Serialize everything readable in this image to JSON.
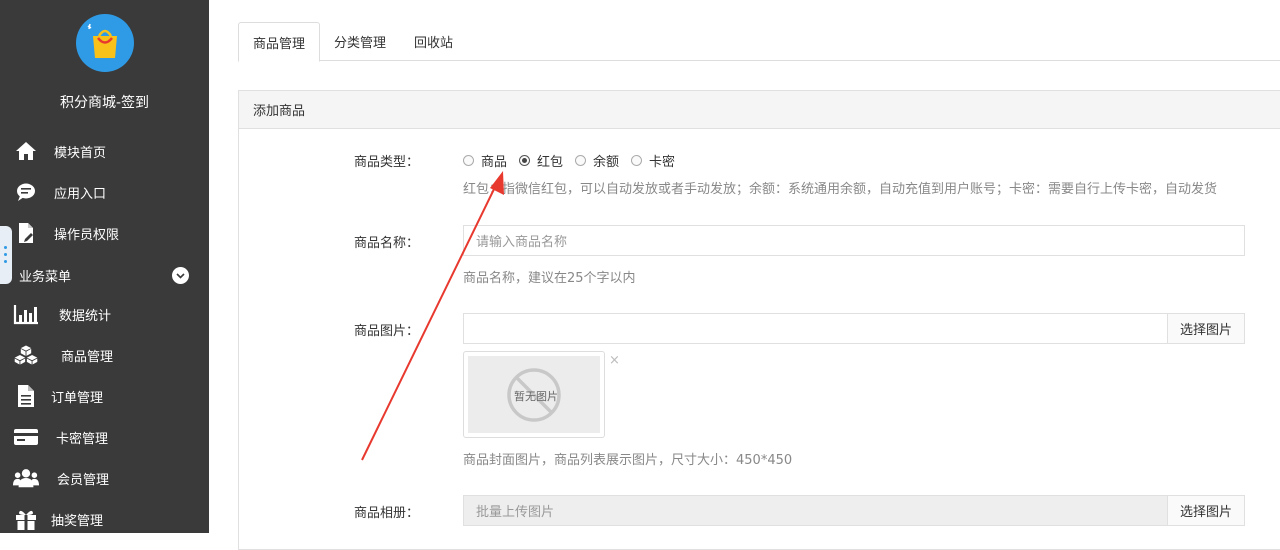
{
  "sidebar": {
    "title": "积分商城-签到",
    "top_items": [
      {
        "label": "模块首页",
        "icon": "home-icon"
      },
      {
        "label": "应用入口",
        "icon": "chat-icon"
      },
      {
        "label": "操作员权限",
        "icon": "document-icon"
      }
    ],
    "section_label": "业务菜单",
    "menu_items": [
      {
        "label": "数据统计",
        "icon": "bar-chart-icon"
      },
      {
        "label": "商品管理",
        "icon": "boxes-icon"
      },
      {
        "label": "订单管理",
        "icon": "file-icon"
      },
      {
        "label": "卡密管理",
        "icon": "card-icon"
      },
      {
        "label": "会员管理",
        "icon": "users-icon"
      },
      {
        "label": "抽奖管理",
        "icon": "gift-icon"
      }
    ]
  },
  "tabs": [
    {
      "label": "商品管理",
      "active": true
    },
    {
      "label": "分类管理",
      "active": false
    },
    {
      "label": "回收站",
      "active": false
    }
  ],
  "panel": {
    "title": "添加商品",
    "type": {
      "label": "商品类型：",
      "options": [
        {
          "label": "商品",
          "checked": false
        },
        {
          "label": "红包",
          "checked": true
        },
        {
          "label": "余额",
          "checked": false
        },
        {
          "label": "卡密",
          "checked": false
        }
      ],
      "help": "红包：指微信红包，可以自动发放或者手动发放；余额：系统通用余额，自动充值到用户账号；卡密：需要自行上传卡密，自动发货"
    },
    "name": {
      "label": "商品名称：",
      "placeholder": "请输入商品名称",
      "help": "商品名称，建议在25个字以内"
    },
    "image": {
      "label": "商品图片：",
      "button": "选择图片",
      "no_image": "暂无图片",
      "close": "×",
      "help": "商品封面图片，商品列表展示图片，尺寸大小：450*450"
    },
    "album": {
      "label": "商品相册：",
      "placeholder": "批量上传图片",
      "button": "选择图片"
    }
  },
  "colors": {
    "sidebar_bg": "#3a3a3a",
    "accent": "#2f9be6",
    "annotation_arrow": "#e8392f"
  }
}
